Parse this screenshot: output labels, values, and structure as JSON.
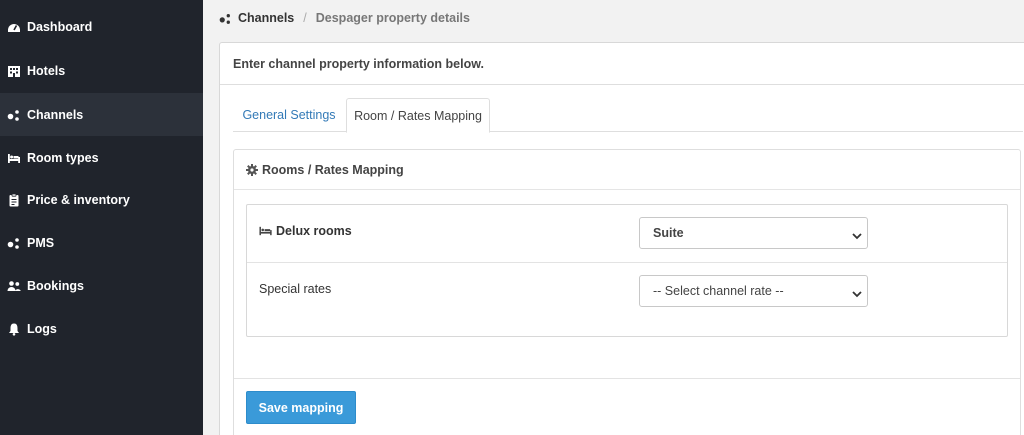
{
  "sidebar": {
    "items": [
      {
        "label": "Dashboard",
        "icon": "dashboard-icon"
      },
      {
        "label": "Hotels",
        "icon": "hotel-icon"
      },
      {
        "label": "Channels",
        "icon": "channels-icon",
        "active": true
      },
      {
        "label": "Room types",
        "icon": "bed-icon"
      },
      {
        "label": "Price & inventory",
        "icon": "clipboard-icon"
      },
      {
        "label": "PMS",
        "icon": "pms-icon"
      },
      {
        "label": "Bookings",
        "icon": "users-icon"
      },
      {
        "label": "Logs",
        "icon": "bell-icon"
      }
    ]
  },
  "breadcrumb": {
    "current": "Channels",
    "separator": "/",
    "page": "Despager property details"
  },
  "card": {
    "header": "Enter channel property information below."
  },
  "tabs": [
    {
      "label": "General Settings",
      "active": false
    },
    {
      "label": "Room / Rates Mapping",
      "active": true
    }
  ],
  "panel": {
    "title": "Rooms / Rates Mapping",
    "rows": [
      {
        "label": "Delux rooms",
        "select_value": "Suite"
      },
      {
        "label": "Special rates",
        "select_value": "-- Select channel rate --"
      }
    ],
    "save_label": "Save mapping"
  },
  "colors": {
    "sidebar_bg": "#20242c",
    "sidebar_active": "#2c313a",
    "link": "#337ab7",
    "primary_button": "#3a9ad9"
  }
}
